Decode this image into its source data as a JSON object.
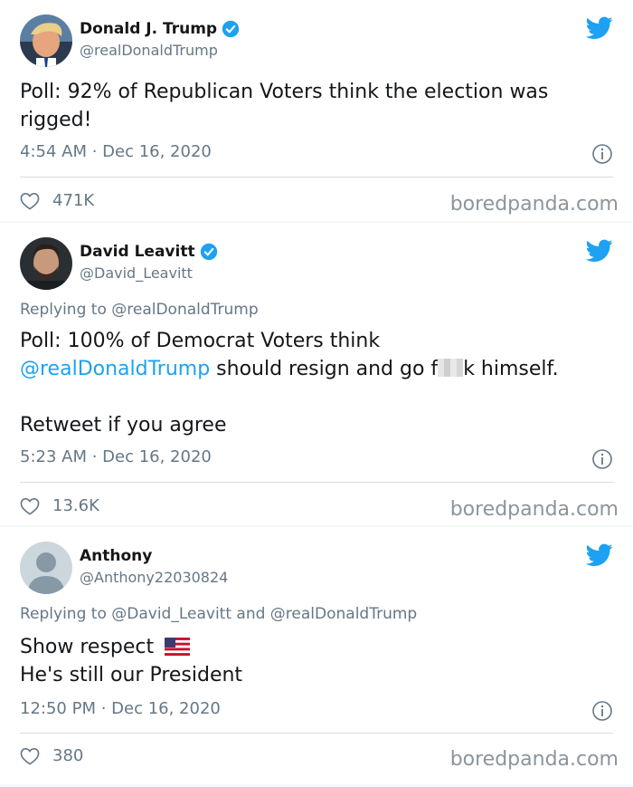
{
  "brand_color": "#1da1f2",
  "watermark": "boredpanda.com",
  "tweets": [
    {
      "name": "Donald J. Trump",
      "handle": "@realDonaldTrump",
      "verified": true,
      "avatar_icon": "trump-avatar",
      "text": "Poll: 92% of Republican Voters think the election was rigged!",
      "line1": "Poll: 92% of Republican Voters think the election was",
      "line2": "rigged!",
      "time": "4:54 AM · Dec 16, 2020",
      "likes": "471K"
    },
    {
      "name": "David Leavitt",
      "handle": "@David_Leavitt",
      "verified": true,
      "avatar_icon": "david-avatar",
      "replying_prefix": "Replying to",
      "replying_to": "@realDonaldTrump",
      "line1": "Poll: 100% of Democrat Voters think",
      "mention": "@realDonaldTrump",
      "line2_after_mention": " should resign and go f",
      "line2_tail": "k himself.",
      "line3": "Retweet if you agree",
      "time": "5:23 AM · Dec 16, 2020",
      "likes": "13.6K"
    },
    {
      "name": "Anthony",
      "handle": "@Anthony22030824",
      "verified": false,
      "avatar_icon": "default-avatar",
      "replying_prefix": "Replying to",
      "replying_to_1": "@David_Leavitt",
      "replying_and": "and",
      "replying_to_2": "@realDonaldTrump",
      "line1": "Show respect",
      "flag_icon": "us-flag-icon",
      "line2": "He's still our President",
      "time": "12:50 PM · Dec 16, 2020",
      "likes": "380"
    }
  ]
}
